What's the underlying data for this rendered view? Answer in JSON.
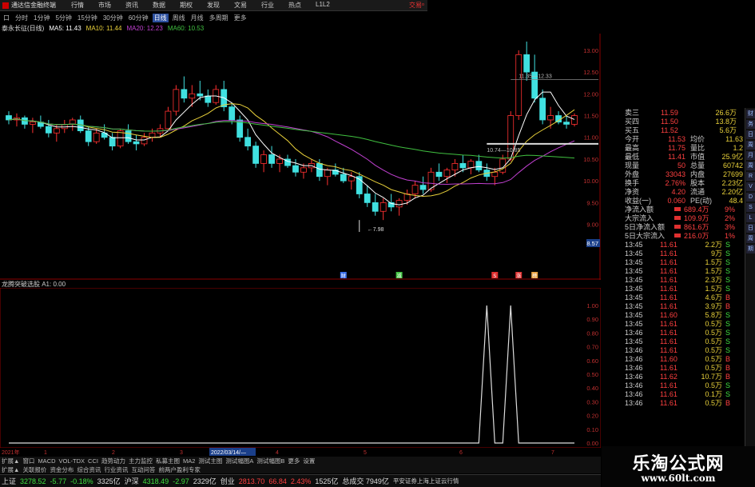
{
  "titlebar": {
    "app_title": "通达信金融终端",
    "menu": [
      "行情",
      "市场",
      "资讯",
      "数据",
      "期权",
      "发现",
      "文易",
      "行业",
      "热点",
      "L1L2"
    ],
    "trade": "交易ᵒ"
  },
  "periodbar": {
    "items": [
      "口",
      "分时",
      "1分钟",
      "5分钟",
      "15分钟",
      "30分钟",
      "60分钟",
      "日线",
      "周线",
      "月线",
      "多周期",
      "更多"
    ],
    "active_index": 7
  },
  "ma_legend": {
    "stock": "泰永长征(日线)",
    "items": [
      {
        "label": "MA5: 11.43",
        "color": "#ffffff"
      },
      {
        "label": "MA10: 11.44",
        "color": "#e8d03a"
      },
      {
        "label": "MA20: 12.23",
        "color": "#c040d0"
      },
      {
        "label": "MA60: 10.53",
        "color": "#40c040"
      }
    ]
  },
  "price_axis": [
    "13.00",
    "12.50",
    "12.00",
    "11.50",
    "11.00",
    "10.50",
    "10.00",
    "9.50",
    "9.00",
    "8.57"
  ],
  "annotations": {
    "high_box": "11.35—12.33",
    "low_box": "10.74—10.85",
    "low_price": "←7.98",
    "markers": [
      "财",
      "减",
      "S",
      "涨",
      "榜"
    ]
  },
  "indicator": {
    "label": "龙腾突破选股 A1: 0.00",
    "axis": [
      "1.00",
      "0.90",
      "0.80",
      "0.70",
      "0.60",
      "0.50",
      "0.40",
      "0.30",
      "0.20",
      "0.10",
      "0.00"
    ]
  },
  "chart_data": [
    {
      "type": "candlestick",
      "title": "泰永长征(日线)",
      "ylim": [
        8.57,
        13.2
      ],
      "candles": [
        [
          11.5,
          11.6,
          11.3,
          11.4
        ],
        [
          11.4,
          11.55,
          11.25,
          11.45
        ],
        [
          11.45,
          11.5,
          11.2,
          11.3
        ],
        [
          11.3,
          11.45,
          11.1,
          11.35
        ],
        [
          11.35,
          11.5,
          11.2,
          11.25
        ],
        [
          11.25,
          11.4,
          11.0,
          11.1
        ],
        [
          11.1,
          11.3,
          10.9,
          11.2
        ],
        [
          11.2,
          11.4,
          11.1,
          11.3
        ],
        [
          11.3,
          11.45,
          11.15,
          11.4
        ],
        [
          11.4,
          11.5,
          11.1,
          11.15
        ],
        [
          11.15,
          11.25,
          10.8,
          10.9
        ],
        [
          10.9,
          11.2,
          10.85,
          11.1
        ],
        [
          11.1,
          11.3,
          10.95,
          11.0
        ],
        [
          11.0,
          11.1,
          10.7,
          10.8
        ],
        [
          10.8,
          11.2,
          10.75,
          11.15
        ],
        [
          11.15,
          11.3,
          10.85,
          10.9
        ],
        [
          10.9,
          11.05,
          10.7,
          10.85
        ],
        [
          10.85,
          11.1,
          10.8,
          11.0
        ],
        [
          11.0,
          11.2,
          10.9,
          11.1
        ],
        [
          11.1,
          11.3,
          11.0,
          11.2
        ],
        [
          11.2,
          11.7,
          11.15,
          11.6
        ],
        [
          11.6,
          12.2,
          11.5,
          12.1
        ],
        [
          12.1,
          12.4,
          11.8,
          11.9
        ],
        [
          11.9,
          12.2,
          11.7,
          12.0
        ],
        [
          12.0,
          12.3,
          11.85,
          11.95
        ],
        [
          11.95,
          12.1,
          11.7,
          11.8
        ],
        [
          11.8,
          12.2,
          11.75,
          12.1
        ],
        [
          12.1,
          12.3,
          11.6,
          11.7
        ],
        [
          11.7,
          11.8,
          11.3,
          11.4
        ],
        [
          11.4,
          11.5,
          10.9,
          11.0
        ],
        [
          11.0,
          11.2,
          10.7,
          10.8
        ],
        [
          10.8,
          10.9,
          10.3,
          10.4
        ],
        [
          10.4,
          10.7,
          10.2,
          10.6
        ],
        [
          10.6,
          10.8,
          10.3,
          10.4
        ],
        [
          10.4,
          10.6,
          10.2,
          10.5
        ],
        [
          10.5,
          10.6,
          10.3,
          10.35
        ],
        [
          10.35,
          10.5,
          10.1,
          10.2
        ],
        [
          10.2,
          10.4,
          10.05,
          10.3
        ],
        [
          10.3,
          10.5,
          10.2,
          10.4
        ],
        [
          10.4,
          10.5,
          10.0,
          10.1
        ],
        [
          10.1,
          10.3,
          9.9,
          10.25
        ],
        [
          10.25,
          10.4,
          10.1,
          10.15
        ],
        [
          10.15,
          10.3,
          9.95,
          10.0
        ],
        [
          10.0,
          10.2,
          9.8,
          10.1
        ],
        [
          10.1,
          10.2,
          9.6,
          9.7
        ],
        [
          9.7,
          9.9,
          9.4,
          9.5
        ],
        [
          9.5,
          9.7,
          9.2,
          9.3
        ],
        [
          9.3,
          9.6,
          9.1,
          9.5
        ],
        [
          9.5,
          9.7,
          9.3,
          9.4
        ],
        [
          9.4,
          9.6,
          9.2,
          9.55
        ],
        [
          9.55,
          9.8,
          9.45,
          9.7
        ],
        [
          9.7,
          10.0,
          9.6,
          9.9
        ],
        [
          9.9,
          10.1,
          9.7,
          9.8
        ],
        [
          9.8,
          10.3,
          9.75,
          10.2
        ],
        [
          10.2,
          10.4,
          10.0,
          10.1
        ],
        [
          10.1,
          10.3,
          9.95,
          10.25
        ],
        [
          10.25,
          10.5,
          10.1,
          10.4
        ],
        [
          10.4,
          10.6,
          10.2,
          10.3
        ],
        [
          10.3,
          10.5,
          10.15,
          10.45
        ],
        [
          10.45,
          10.6,
          10.2,
          10.25
        ],
        [
          10.25,
          10.4,
          10.0,
          10.1
        ],
        [
          10.1,
          10.3,
          9.9,
          10.2
        ],
        [
          10.2,
          10.6,
          10.15,
          10.5
        ],
        [
          10.5,
          11.6,
          10.45,
          11.5
        ],
        [
          11.5,
          13.0,
          11.4,
          12.9
        ],
        [
          12.9,
          13.2,
          12.3,
          12.5
        ],
        [
          12.5,
          12.9,
          11.8,
          11.9
        ],
        [
          11.9,
          12.1,
          11.3,
          11.4
        ],
        [
          11.4,
          11.7,
          11.2,
          11.5
        ],
        [
          11.5,
          11.6,
          11.3,
          11.35
        ],
        [
          11.35,
          11.5,
          11.2,
          11.3
        ],
        [
          11.3,
          11.55,
          11.25,
          11.5
        ]
      ]
    },
    {
      "type": "line",
      "title": "龙腾突破选股",
      "ylim": [
        0,
        1.0
      ],
      "signal_indices": [
        60,
        63
      ],
      "count": 72
    }
  ],
  "quote_panel": {
    "rows": [
      {
        "label": "卖三",
        "price": "11.59",
        "vol": "26.6万"
      },
      {
        "label": "买四",
        "price": "11.50",
        "vol": "13.8万"
      },
      {
        "label": "买五",
        "price": "11.52",
        "vol": "5.6万"
      }
    ],
    "stats": [
      {
        "k1": "今开",
        "v1": "11.53",
        "k2": "均价",
        "v2": "11.63"
      },
      {
        "k1": "最高",
        "v1": "11.75",
        "k2": "量比",
        "v2": "1.2"
      },
      {
        "k1": "最低",
        "v1": "11.41",
        "k2": "市值",
        "v2": "25.9亿"
      },
      {
        "k1": "现量",
        "v1": "50",
        "k2": "总量",
        "v2": "60742"
      },
      {
        "k1": "外盘",
        "v1": "33043",
        "k2": "内盘",
        "v2": "27699"
      },
      {
        "k1": "换手",
        "v1": "2.76%",
        "k2": "股本",
        "v2": "2.23亿"
      },
      {
        "k1": "净资",
        "v1": "4.20",
        "k2": "流通",
        "v2": "2.20亿"
      },
      {
        "k1": "收益(一)",
        "v1": "0.060",
        "k2": "PE(动)",
        "v2": "48.4"
      }
    ],
    "flows": [
      {
        "label": "净流入额",
        "value": "689.4万",
        "pct": "9%"
      },
      {
        "label": "大宗流入",
        "value": "109.9万",
        "pct": "2%"
      },
      {
        "label": "5日净流入额",
        "value": "861.6万",
        "pct": "3%"
      },
      {
        "label": "5日大宗流入",
        "value": "216.0万",
        "pct": "1%"
      }
    ],
    "ticks": [
      [
        "13:45",
        "11.61",
        "2.2万",
        "S"
      ],
      [
        "13:45",
        "11.61",
        "9万",
        "S"
      ],
      [
        "13:45",
        "11.61",
        "1.5万",
        "S"
      ],
      [
        "13:45",
        "11.61",
        "1.5万",
        "S"
      ],
      [
        "13:45",
        "11.61",
        "2.3万",
        "S"
      ],
      [
        "13:45",
        "11.61",
        "1.5万",
        "S"
      ],
      [
        "13:45",
        "11.61",
        "4.6万",
        "B"
      ],
      [
        "13:45",
        "11.61",
        "3.9万",
        "B"
      ],
      [
        "13:45",
        "11.60",
        "5.8万",
        "S"
      ],
      [
        "13:45",
        "11.61",
        "0.5万",
        "S"
      ],
      [
        "13:46",
        "11.61",
        "0.5万",
        "S"
      ],
      [
        "13:45",
        "11.61",
        "0.5万",
        "S"
      ],
      [
        "13:46",
        "11.61",
        "0.5万",
        "S"
      ],
      [
        "13:46",
        "11.60",
        "0.5万",
        "B"
      ],
      [
        "13:46",
        "11.61",
        "0.5万",
        "B"
      ],
      [
        "13:46",
        "11.62",
        "10.7万",
        "B"
      ],
      [
        "13:46",
        "11.61",
        "0.5万",
        "S"
      ],
      [
        "13:46",
        "11.61",
        "0.1万",
        "S"
      ],
      [
        "13:46",
        "11.61",
        "0.5万",
        "B"
      ]
    ]
  },
  "date_axis": {
    "start": "2021年",
    "cursor": "2022/03/14/—",
    "marks": [
      "1",
      "2",
      "3",
      "4",
      "5",
      "6",
      "7"
    ]
  },
  "tabs": [
    "扩展▲",
    "窗口",
    "MACD",
    "VOL-TDX",
    "CCI",
    "趋势动力",
    "主力监控",
    "私募主图",
    "MA2",
    "测试主图",
    "测试幅图A",
    "测试幅图B",
    "更多",
    "设置"
  ],
  "tabs2": [
    "扩展▲",
    "关联报价",
    "资金分布",
    "综合资讯",
    "行业资讯",
    "互动问答",
    "前两户盈利专家"
  ],
  "status": {
    "items": [
      {
        "name": "上证",
        "value": "3278.52",
        "chg": "-5.77",
        "pct": "-0.18%",
        "amt": "3325亿"
      },
      {
        "name": "沪深",
        "value": "4318.49",
        "chg": "-2.97",
        "pct": "",
        "amt": "2329亿"
      },
      {
        "name": "创业",
        "value": "2813.70",
        "chg": "66.84",
        "pct": "2.43%",
        "amt": "1525亿"
      }
    ],
    "total": "总成交 7949亿",
    "broker": "平安证券上海上证云行情"
  },
  "side_tabs": [
    "财",
    "务",
    "日",
    "周",
    "月",
    "周",
    "R",
    "V",
    "D",
    "S",
    "L",
    "日",
    "周",
    "期"
  ],
  "watermark": {
    "main": "乐淘公式网",
    "url": "www.60lt.com"
  },
  "colors": {
    "up": "#ff3030",
    "down": "#40e0e0",
    "ma5": "#ffffff",
    "ma10": "#e8d03a",
    "ma20": "#c040d0",
    "ma60": "#40c040",
    "grid": "#8b0000"
  }
}
